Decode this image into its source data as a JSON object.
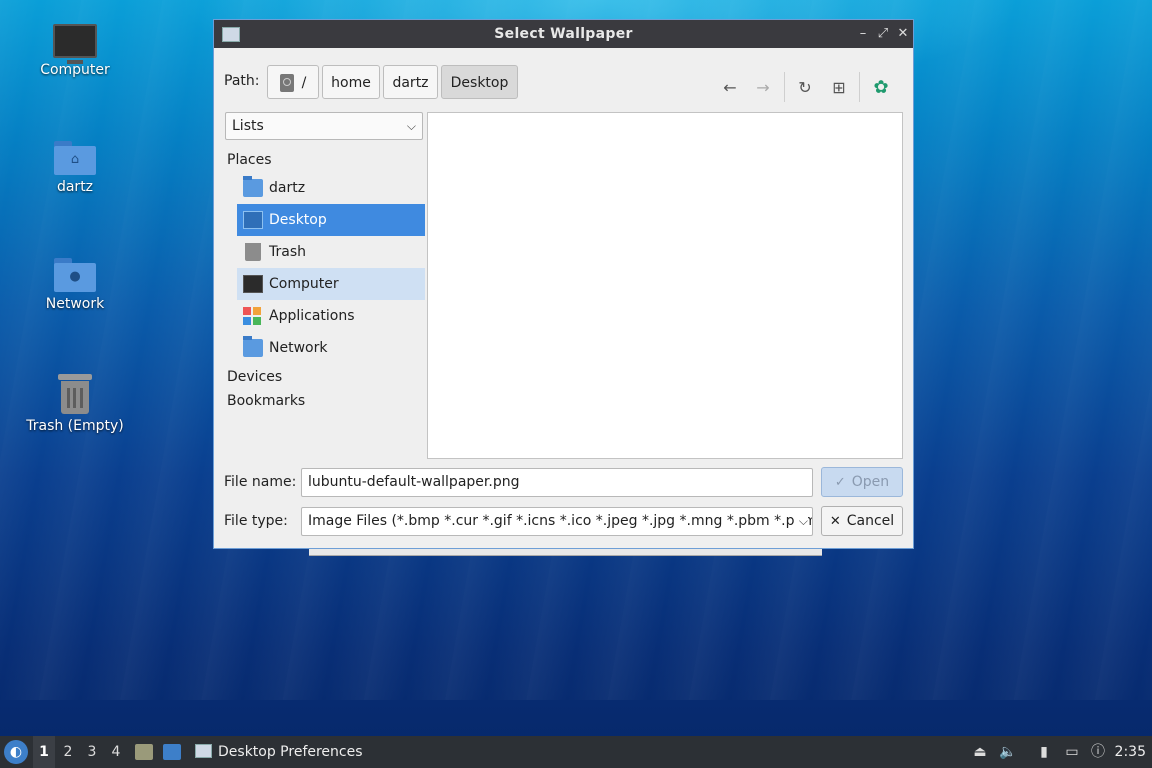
{
  "desktop": {
    "icons": [
      {
        "label": "Computer"
      },
      {
        "label": "dartz"
      },
      {
        "label": "Network"
      },
      {
        "label": "Trash (Empty)"
      }
    ]
  },
  "dialog": {
    "title": "Select Wallpaper",
    "path_label": "Path:",
    "breadcrumbs": [
      "/",
      "home",
      "dartz",
      "Desktop"
    ],
    "view_combo": "Lists",
    "sidebar": {
      "places_header": "Places",
      "items": [
        "dartz",
        "Desktop",
        "Trash",
        "Computer",
        "Applications",
        "Network"
      ],
      "devices_header": "Devices",
      "bookmarks_header": "Bookmarks"
    },
    "file_name_label": "File name:",
    "file_name_value": "lubuntu-default-wallpaper.png",
    "file_type_label": "File type:",
    "file_type_value": "Image Files (*.bmp *.cur *.gif *.icns *.ico *.jpeg *.jpg *.mng *.pbm *.pgm",
    "open_label": "Open",
    "cancel_label": "Cancel"
  },
  "taskbar": {
    "workspaces": [
      "1",
      "2",
      "3",
      "4"
    ],
    "current_workspace": "1",
    "task_label": "Desktop Preferences",
    "clock": "2:35"
  },
  "colors": {
    "selection": "#3f8ae0",
    "titlebar": "#3a3a3f",
    "taskbar": "#2c3035"
  }
}
